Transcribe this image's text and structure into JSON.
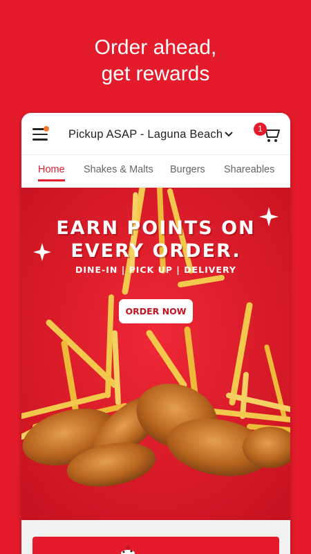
{
  "headline": {
    "line1": "Order ahead,",
    "line2": "get rewards"
  },
  "header": {
    "location": "Pickup ASAP - Laguna Beach",
    "cart_count": "1"
  },
  "tabs": [
    {
      "label": "Home",
      "active": true
    },
    {
      "label": "Shakes & Malts"
    },
    {
      "label": "Burgers"
    },
    {
      "label": "Shareables"
    }
  ],
  "promo": {
    "title_line1": "EARN POINTS ON",
    "title_line2": "EVERY ORDER.",
    "subtitle": "DINE-IN | PICK UP | DELIVERY",
    "button_label": "ORDER NOW"
  },
  "colors": {
    "brand_red": "#e41b2b",
    "accent_orange": "#f0772e"
  }
}
